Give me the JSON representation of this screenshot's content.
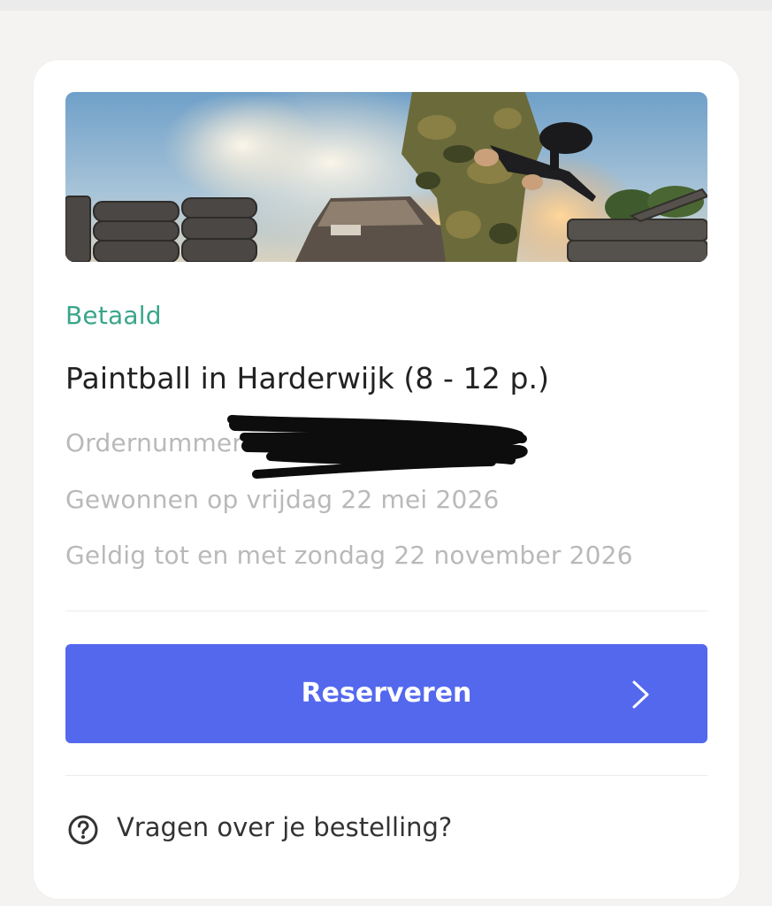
{
  "order": {
    "image_alt": "Paintball player in camouflage holding a paintball marker near tyres",
    "status": "Betaald",
    "title": "Paintball in Harderwijk (8 - 12 p.)",
    "order_number_label": "Ordernummer:",
    "won_date": "Gewonnen op vrijdag 22 mei 2026",
    "valid_until": "Geldig tot en met zondag 22 november 2026"
  },
  "actions": {
    "reserve_label": "Reserveren"
  },
  "help": {
    "label": "Vragen over je bestelling?",
    "icon": "question-circle-icon"
  },
  "colors": {
    "status_green": "#3aa58a",
    "primary_button": "#5468ee",
    "muted_text": "#b9b9b9",
    "page_background": "#f4f3f1"
  }
}
